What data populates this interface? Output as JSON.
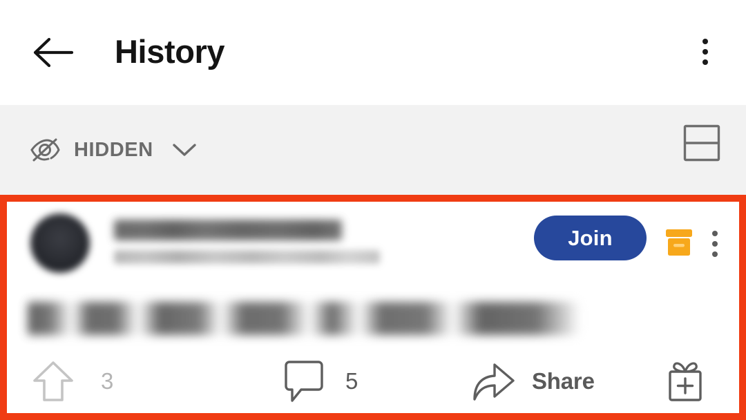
{
  "header": {
    "title": "History",
    "back_icon": "arrow-left-icon",
    "overflow_icon": "kebab-menu-icon"
  },
  "filter_bar": {
    "label": "HIDDEN",
    "visibility_icon": "eye-off-icon",
    "chevron_icon": "chevron-down-icon",
    "layout_toggle_icon": "card-layout-icon",
    "background_color": "#f2f2f2"
  },
  "annotation": {
    "color": "#f03c13",
    "border_width": "10px"
  },
  "post": {
    "avatar_icon": "subreddit-avatar",
    "subreddit_name": "",
    "metadata": "",
    "title": "",
    "join_label": "Join",
    "join_color": "#27489c",
    "archive_icon": "archive-box-icon",
    "archive_color": "#f7a81b",
    "overflow_icon": "kebab-menu-icon",
    "actions": {
      "upvote": {
        "icon": "upvote-arrow-icon",
        "count": "3"
      },
      "comment": {
        "icon": "comment-bubble-icon",
        "count": "5"
      },
      "share": {
        "icon": "share-arrow-icon",
        "label": "Share"
      },
      "award": {
        "icon": "gift-award-icon"
      }
    }
  }
}
